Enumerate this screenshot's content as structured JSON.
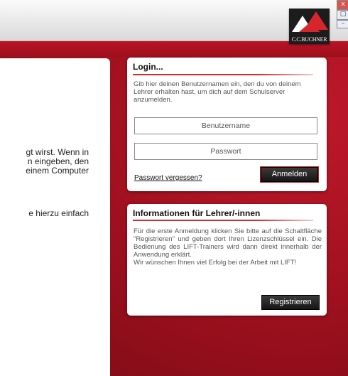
{
  "logo": {
    "text": "C.C.BUCHNER"
  },
  "window_controls": {
    "close": "x",
    "maximize": "□",
    "minimize": "–"
  },
  "content": {
    "line1": "gt wirst. Wenn in",
    "line2": "n eingeben, den",
    "line3": "einem Computer",
    "line4": "e hierzu einfach"
  },
  "login": {
    "title": "Login...",
    "description": "Gib hier deinen Benutzernamen ein, den du von deinem Lehrer erhalten hast, um dich auf dem Schulserver anzumelden.",
    "username_placeholder": "Benutzername",
    "password_placeholder": "Passwort",
    "forgot_link": "Passwort vergessen?",
    "submit_label": "Anmelden"
  },
  "info": {
    "title": "Informationen für Lehrer/-innen",
    "text1": "Für die erste Anmeldung klicken Sie bitte auf die Schaltfläche \"Registrieren\" und geben dort Ihren Lizenzschlüssel ein. Die Bedienung des LIFT-Trainers wird dann direkt innerhalb der Anwendung erklärt.",
    "text2": "Wir wünschen Ihnen viel Erfolg bei der Arbeit mit LIFT!",
    "register_label": "Registrieren"
  },
  "colors": {
    "brand_red": "#b81425",
    "button_dark": "#1a1a1a",
    "accent_line": "#d42d2d"
  }
}
